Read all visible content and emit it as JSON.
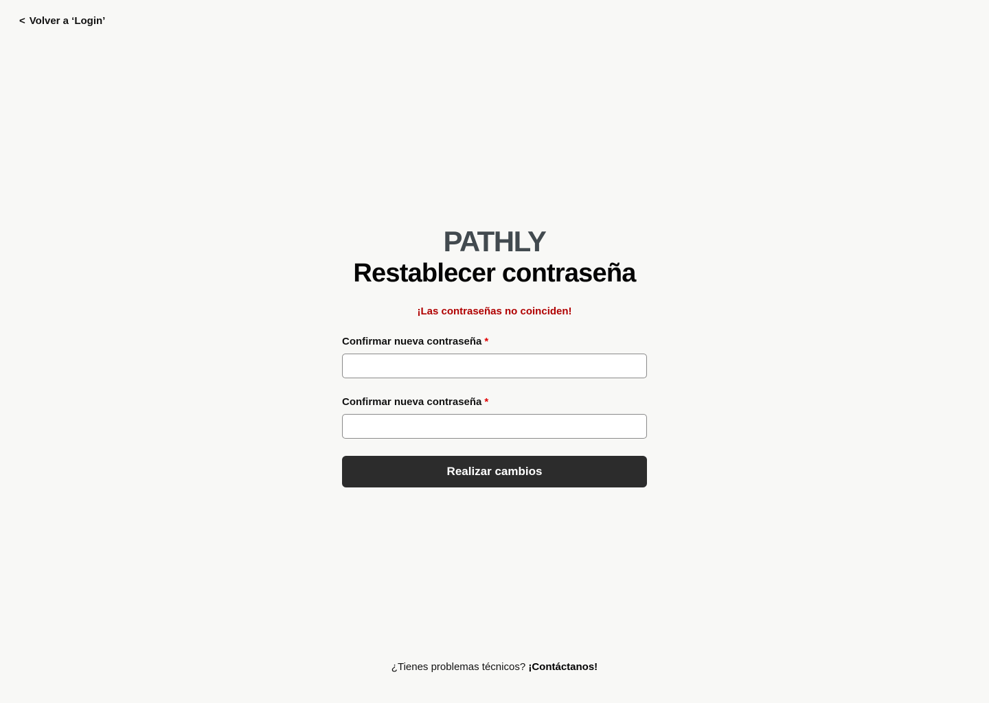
{
  "nav": {
    "back_chevron": "<",
    "back_label": "Volver a ‘Login’"
  },
  "brand": {
    "logo_text": "PATHLY",
    "logo_color": "#424a4f"
  },
  "form": {
    "title": "Restablecer contraseña",
    "error_message": "¡Las contraseñas no coinciden!",
    "error_color": "#b00000",
    "fields": [
      {
        "label": "Confirmar nueva contraseña",
        "required_mark": "*",
        "value": ""
      },
      {
        "label": "Confirmar nueva contraseña",
        "required_mark": "*",
        "value": ""
      }
    ],
    "submit_label": "Realizar cambios",
    "submit_color": "#2c2c2c"
  },
  "footer": {
    "text": "¿Tienes problemas técnicos?",
    "contact_label": "¡Contáctanos!"
  }
}
